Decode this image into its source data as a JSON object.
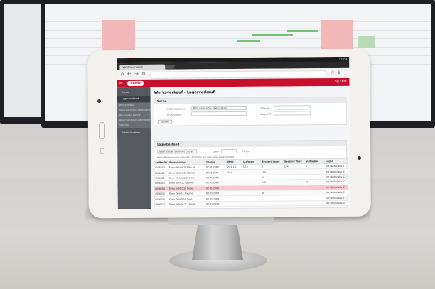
{
  "photo": {
    "background": "office desk with monitors",
    "device": "tablet on aluminium stand"
  },
  "browser": {
    "tab_title": "Werksversand",
    "status_right": "12:04"
  },
  "header": {
    "logo": "ELMO",
    "logout": "Log Out",
    "brand_color": "#c8102e"
  },
  "sidebar": {
    "items": [
      {
        "label": "Home",
        "active": false
      },
      {
        "label": "Lagerbestand",
        "active": true
      }
    ],
    "subitems": [
      "Werksverkauf",
      "Reservierungen Werksverkauf",
      "Buchungen Lieferer",
      "Reservierungen Lieferanten",
      "Statistik"
    ],
    "bottom_item": "Administration"
  },
  "main": {
    "title": "Werksverkauf - Lagerverkauf",
    "filter": {
      "heading": "Suche",
      "field1_label": "Artikelnummer",
      "field1_value": "Bitte wählen Sie einen Eintrag",
      "field2_label": "Artikelname",
      "field3_label": "Charge",
      "field4_label": "Lagerort",
      "search_button": "Suchen"
    },
    "stock": {
      "heading": "Lagerbestand",
      "filter_label": "Bitte wählen Sie einen Eintrag",
      "filter_mid": "Lager",
      "filter_right": "Menge",
      "notice": "Keine Reservierung gefunden. Erstellen Sie eine neue Reservierung"
    },
    "table": {
      "columns": [
        "Artikel-Nr.",
        "Bezeichnung",
        "Charge",
        "MHD",
        "Lieferant",
        "Bestand Lager",
        "Bestand Werk",
        "Verfügbar",
        "Lager"
      ],
      "rows": [
        {
          "art": "4006010",
          "name": "Elmo Deluxe 1L Flasche",
          "charge": "02.01.2019",
          "mhd": "2/18 1.1",
          "lief": "1/12",
          "lager": "9",
          "werk": "124",
          "verf": "5",
          "ort": "Ost Werkshalle A1",
          "highlight": false
        },
        {
          "art": "4006011",
          "name": "Elmo Classic 1L Flasche",
          "charge": "02.01.2019",
          "mhd": "3/19",
          "lief": "",
          "lager": "150",
          "werk": "",
          "verf": "",
          "ort": "Ost Werkshalle A1",
          "highlight": false
        },
        {
          "art": "4006012",
          "name": "Elmo Classic 0.5L Dose",
          "charge": "02.01.2019",
          "mhd": "",
          "lief": "",
          "lager": "24",
          "werk": "",
          "verf": "",
          "ort": "Ost Werkshalle A2",
          "highlight": false
        },
        {
          "art": "4006013",
          "name": "Elmo Light 1L Flasche",
          "charge": "02.01.2019",
          "mhd": "",
          "lief": "",
          "lager": "240",
          "werk": "",
          "verf": "10",
          "ort": "Ost Werkshalle A2",
          "highlight": false
        },
        {
          "art": "4006014",
          "name": "Elmo Light 0.5L Dose",
          "charge": "02.01.2019",
          "mhd": "",
          "lief": "",
          "lager": "",
          "werk": "",
          "verf": "",
          "ort": "Ost Werkshalle B1",
          "highlight": true
        },
        {
          "art": "4006015",
          "name": "Elmo Zero 1L Flasche",
          "charge": "02.01.2019",
          "mhd": "",
          "lief": "",
          "lager": "48",
          "werk": "",
          "verf": "",
          "ort": "Ost Werkshalle B1",
          "highlight": false
        },
        {
          "art": "4006016",
          "name": "Elmo Zero 0.5L Dose",
          "charge": "02.01.2019",
          "mhd": "",
          "lief": "",
          "lager": "",
          "werk": "",
          "verf": "",
          "ort": "Ost Werkshalle B2",
          "highlight": false
        },
        {
          "art": "4006017",
          "name": "Elmo Orange 1L Flasche",
          "charge": "02.01.2019",
          "mhd": "",
          "lief": "",
          "lager": "",
          "werk": "",
          "verf": "",
          "ort": "Ost Werkshalle B2",
          "highlight": false
        }
      ]
    }
  }
}
